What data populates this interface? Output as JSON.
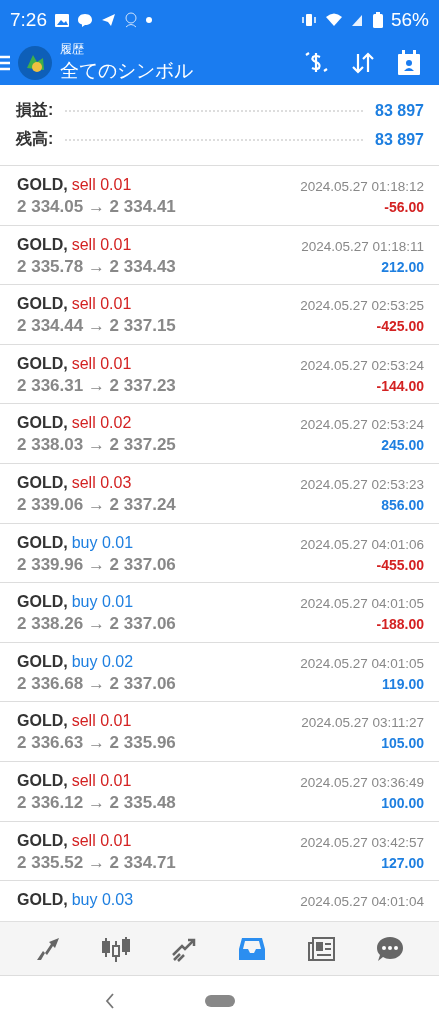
{
  "status_bar": {
    "time": "7:26",
    "battery": "56%"
  },
  "app_bar": {
    "subtitle": "履歴",
    "title": "全てのシンボル"
  },
  "summary": [
    {
      "label": "損益:",
      "value": "83 897"
    },
    {
      "label": "残高:",
      "value": "83 897"
    }
  ],
  "deals": [
    {
      "symbol": "GOLD,",
      "side": "sell",
      "volume": "0.01",
      "prices": "2 334.05 → 2 334.41",
      "time": "2024.05.27 01:18:12",
      "profit": "-56.00",
      "kind": "loss"
    },
    {
      "symbol": "GOLD,",
      "side": "sell",
      "volume": "0.01",
      "prices": "2 335.78 → 2 334.43",
      "time": "2024.05.27 01:18:11",
      "profit": "212.00",
      "kind": "gain"
    },
    {
      "symbol": "GOLD,",
      "side": "sell",
      "volume": "0.01",
      "prices": "2 334.44 → 2 337.15",
      "time": "2024.05.27 02:53:25",
      "profit": "-425.00",
      "kind": "loss"
    },
    {
      "symbol": "GOLD,",
      "side": "sell",
      "volume": "0.01",
      "prices": "2 336.31 → 2 337.23",
      "time": "2024.05.27 02:53:24",
      "profit": "-144.00",
      "kind": "loss"
    },
    {
      "symbol": "GOLD,",
      "side": "sell",
      "volume": "0.02",
      "prices": "2 338.03 → 2 337.25",
      "time": "2024.05.27 02:53:24",
      "profit": "245.00",
      "kind": "gain"
    },
    {
      "symbol": "GOLD,",
      "side": "sell",
      "volume": "0.03",
      "prices": "2 339.06 → 2 337.24",
      "time": "2024.05.27 02:53:23",
      "profit": "856.00",
      "kind": "gain"
    },
    {
      "symbol": "GOLD,",
      "side": "buy",
      "volume": "0.01",
      "prices": "2 339.96 → 2 337.06",
      "time": "2024.05.27 04:01:06",
      "profit": "-455.00",
      "kind": "loss"
    },
    {
      "symbol": "GOLD,",
      "side": "buy",
      "volume": "0.01",
      "prices": "2 338.26 → 2 337.06",
      "time": "2024.05.27 04:01:05",
      "profit": "-188.00",
      "kind": "loss"
    },
    {
      "symbol": "GOLD,",
      "side": "buy",
      "volume": "0.02",
      "prices": "2 336.68 → 2 337.06",
      "time": "2024.05.27 04:01:05",
      "profit": "119.00",
      "kind": "gain"
    },
    {
      "symbol": "GOLD,",
      "side": "sell",
      "volume": "0.01",
      "prices": "2 336.63 → 2 335.96",
      "time": "2024.05.27 03:11:27",
      "profit": "105.00",
      "kind": "gain"
    },
    {
      "symbol": "GOLD,",
      "side": "sell",
      "volume": "0.01",
      "prices": "2 336.12 → 2 335.48",
      "time": "2024.05.27 03:36:49",
      "profit": "100.00",
      "kind": "gain"
    },
    {
      "symbol": "GOLD,",
      "side": "sell",
      "volume": "0.01",
      "prices": "2 335.52 → 2 334.71",
      "time": "2024.05.27 03:42:57",
      "profit": "127.00",
      "kind": "gain"
    },
    {
      "symbol": "GOLD,",
      "side": "buy",
      "volume": "0.03",
      "time": "2024.05.27 04:01:04"
    }
  ],
  "bottom_tabs": [
    {
      "kind": "quotes",
      "selected": false
    },
    {
      "kind": "chart",
      "selected": false
    },
    {
      "kind": "trade",
      "selected": false
    },
    {
      "kind": "history",
      "selected": true
    },
    {
      "kind": "news",
      "selected": false
    },
    {
      "kind": "messages",
      "selected": false
    }
  ]
}
